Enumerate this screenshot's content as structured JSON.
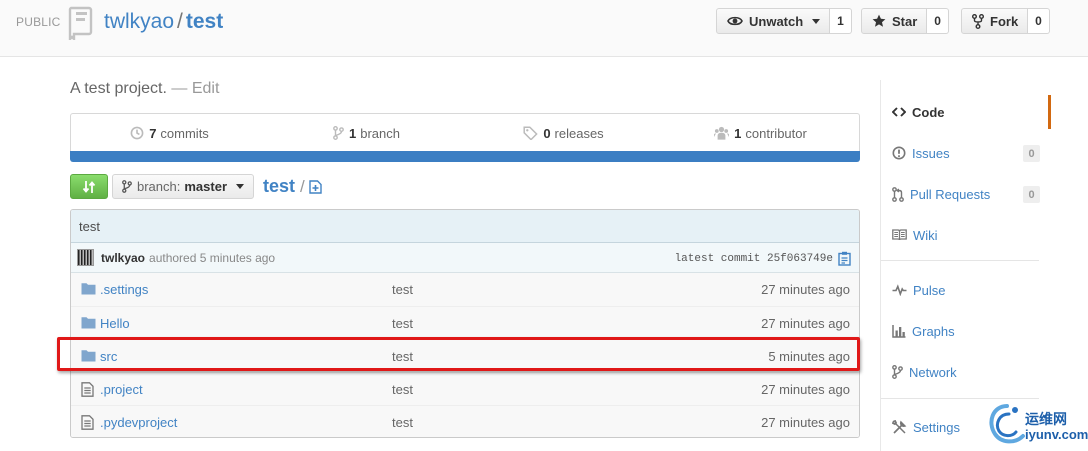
{
  "header": {
    "visibility_label": "PUBLIC",
    "owner": "twlkyao",
    "separator": "/",
    "repo": "test",
    "watch": {
      "label": "Unwatch",
      "count": "1",
      "icon": "eye-icon"
    },
    "star": {
      "label": "Star",
      "count": "0",
      "icon": "star-icon"
    },
    "fork": {
      "label": "Fork",
      "count": "0",
      "icon": "fork-icon"
    }
  },
  "description": {
    "text": "A test project.",
    "edit_label": "— Edit"
  },
  "stats": [
    {
      "icon": "history-icon",
      "num": "7",
      "label": "commits"
    },
    {
      "icon": "branch-icon",
      "num": "1",
      "label": "branch"
    },
    {
      "icon": "tag-icon",
      "num": "0",
      "label": "releases"
    },
    {
      "icon": "organization-icon",
      "num": "1",
      "label": "contributor"
    }
  ],
  "language_bar_color": "#3b7ec3",
  "filenav": {
    "branch_prefix": "branch:",
    "branch_name": "master",
    "path_root": "test",
    "path_separator": "/"
  },
  "commit": {
    "message": "test",
    "author": "twlkyao",
    "authored_text": "authored 5 minutes ago",
    "latest_label": "latest commit 25f063749e"
  },
  "files": [
    {
      "type": "folder",
      "name": ".settings",
      "message": "test",
      "age": "27 minutes ago"
    },
    {
      "type": "folder",
      "name": "Hello",
      "message": "test",
      "age": "27 minutes ago"
    },
    {
      "type": "folder",
      "name": "src",
      "message": "test",
      "age": "5 minutes ago"
    },
    {
      "type": "file",
      "name": ".project",
      "message": "test",
      "age": "27 minutes ago"
    },
    {
      "type": "file",
      "name": ".pydevproject",
      "message": "test",
      "age": "27 minutes ago"
    }
  ],
  "sidebar": {
    "items": [
      {
        "label": "Code",
        "icon": "code-icon",
        "selected": true
      },
      {
        "label": "Issues",
        "icon": "issue-icon",
        "counter": "0"
      },
      {
        "label": "Pull Requests",
        "icon": "pull-request-icon",
        "counter": "0"
      },
      {
        "label": "Wiki",
        "icon": "wiki-icon"
      },
      {
        "label": "Pulse",
        "icon": "pulse-icon"
      },
      {
        "label": "Graphs",
        "icon": "graph-icon"
      },
      {
        "label": "Network",
        "icon": "network-icon"
      },
      {
        "label": "Settings",
        "icon": "tools-icon"
      }
    ]
  },
  "watermark": {
    "cn": "运维网",
    "en": "iyunv.com"
  },
  "colors": {
    "link": "#4183c4",
    "accent": "#d26911",
    "highlight": "#e01818",
    "compare_green": "#60b044"
  }
}
